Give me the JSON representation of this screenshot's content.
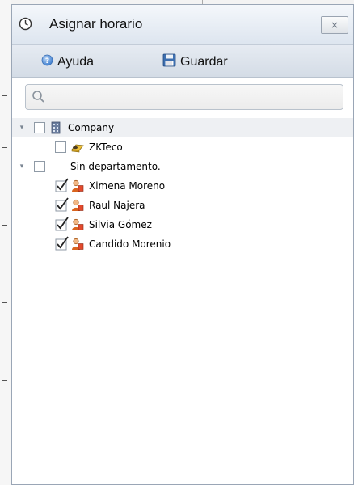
{
  "window": {
    "title": "Asignar horario",
    "title_icon": "clock-icon",
    "close_label": "×"
  },
  "toolbar": {
    "help_label": "Ayuda",
    "help_icon": "help-icon",
    "save_label": "Guardar",
    "save_icon": "floppy-disk-icon"
  },
  "search": {
    "placeholder": "",
    "value": "",
    "icon": "search-icon"
  },
  "tree": {
    "company": {
      "label": "Company",
      "icon": "building-icon",
      "checked": false,
      "expanded": true
    },
    "zkteco": {
      "label": "ZKTeco",
      "icon": "department-icon",
      "checked": false
    },
    "no_department": {
      "label": "Sin departamento.",
      "checked": false,
      "expanded": true
    },
    "employees": [
      {
        "label": "Ximena Moreno",
        "checked": true,
        "icon": "user-icon"
      },
      {
        "label": "Raul Najera",
        "checked": true,
        "icon": "user-icon"
      },
      {
        "label": "Silvia Gómez",
        "checked": true,
        "icon": "user-icon"
      },
      {
        "label": "Candido Morenio",
        "checked": true,
        "icon": "user-icon"
      }
    ]
  },
  "colors": {
    "titlebar": "#dde5ef",
    "toolbar": "#d4dce6",
    "border": "#9aa6b6",
    "user_icon": "#d9641e"
  }
}
